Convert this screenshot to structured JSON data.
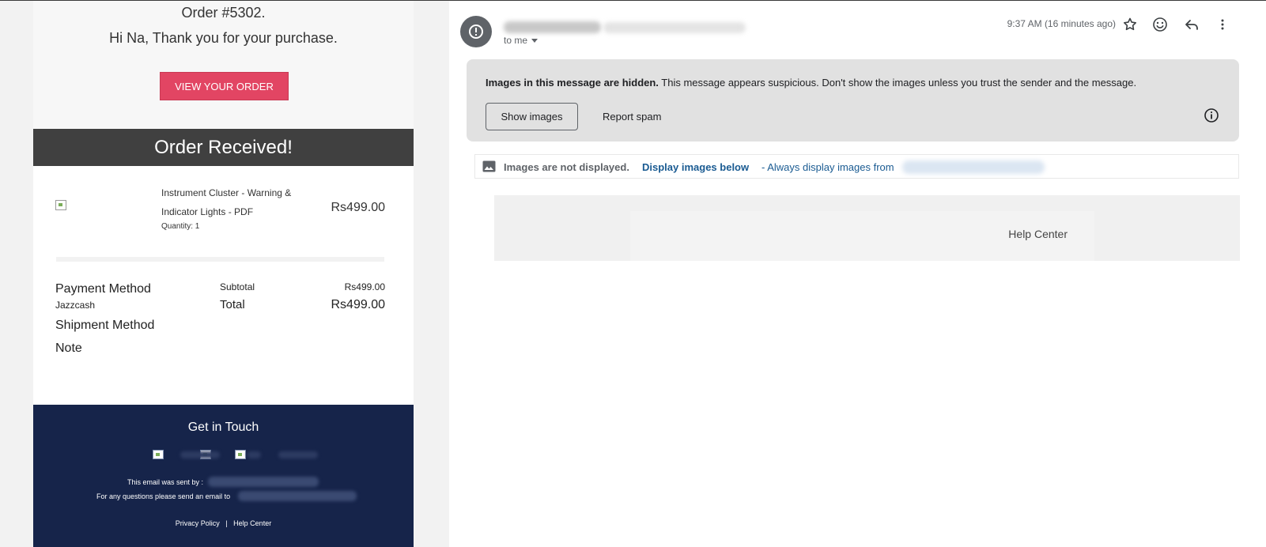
{
  "email": {
    "order_number": "Order #5302.",
    "greeting": "Hi Na, Thank you for your purchase.",
    "view_order_button": "VIEW YOUR ORDER",
    "banner_title": "Order Received!",
    "item": {
      "title": "Instrument Cluster - Warning & Indicator Lights - PDF",
      "quantity": "Quantity: 1",
      "price": "Rs499.00"
    },
    "summary": {
      "payment_method_label": "Payment Method",
      "payment_method_value": "Jazzcash",
      "shipment_method_label": "Shipment Method",
      "note_label": "Note",
      "subtotal_label": "Subtotal",
      "subtotal_value": "Rs499.00",
      "total_label": "Total",
      "total_value": "Rs499.00"
    },
    "footer": {
      "heading": "Get in Touch",
      "sent_by": "This email was sent by :",
      "questions": "For any questions please send an email to",
      "privacy_policy": "Privacy Policy",
      "separator": "|",
      "help_center": "Help Center"
    }
  },
  "client": {
    "to_me": "to me",
    "timestamp": "9:37 AM (16 minutes ago)",
    "warning": {
      "bold": "Images in this message are hidden.",
      "rest": " This message appears suspicious. Don't show the images unless you trust the sender and the message.",
      "show_images": "Show images",
      "report_spam": "Report spam"
    },
    "images_bar": {
      "not_displayed": "Images are not displayed.",
      "display_below": "Display images below",
      "always_display": "- Always display images from"
    },
    "help_center": "Help Center"
  },
  "icons": {
    "avatar": "alert-circle-icon",
    "star": "star-icon",
    "emoji": "emoji-icon",
    "reply": "reply-icon",
    "more": "more-vert-icon",
    "info": "info-icon",
    "image": "image-icon"
  },
  "colors": {
    "accent_button": "#e24563",
    "banner": "#404040",
    "footer": "#16244a",
    "link": "#1a5b92",
    "warning_bg": "#e1e1e1"
  }
}
